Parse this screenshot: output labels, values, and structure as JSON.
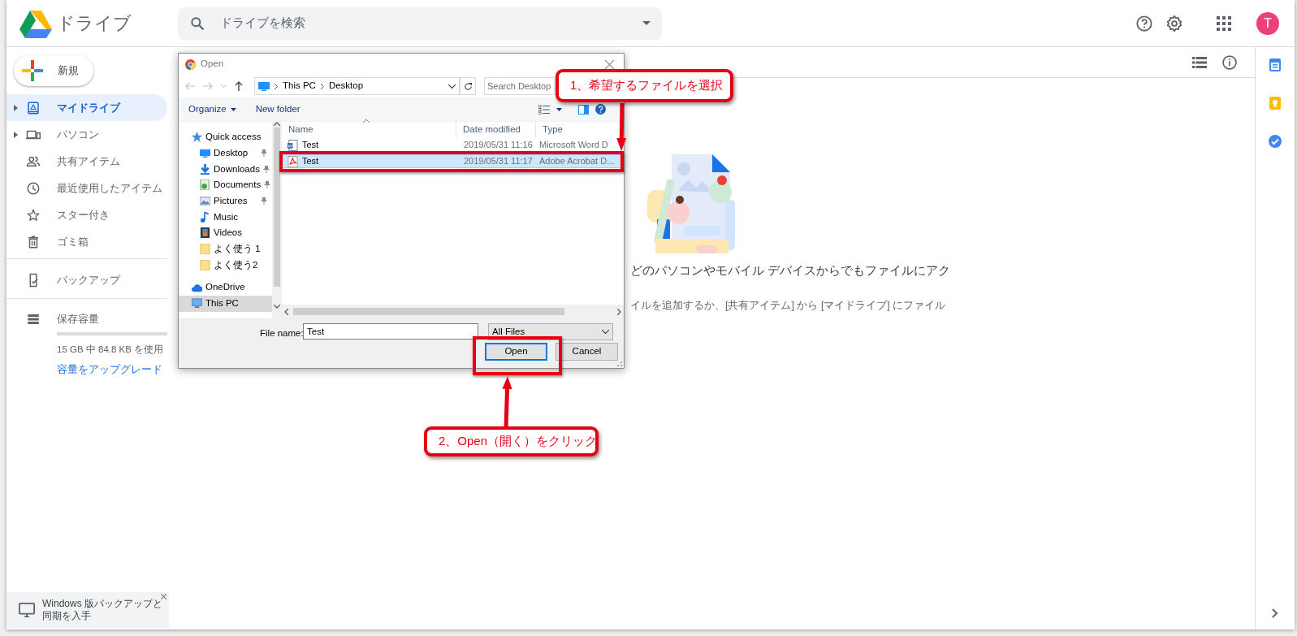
{
  "app": {
    "title": "ドライブ"
  },
  "search": {
    "placeholder": "ドライブを検索"
  },
  "account": {
    "initial": "T"
  },
  "new_button": {
    "label": "新規"
  },
  "sidebar": {
    "groups": [
      {
        "items": [
          {
            "label": "マイドライブ",
            "expandable": true,
            "selected": true
          },
          {
            "label": "パソコン",
            "expandable": true,
            "selected": false
          },
          {
            "label": "共有アイテム",
            "expandable": false,
            "selected": false
          },
          {
            "label": "最近使用したアイテム",
            "expandable": false,
            "selected": false
          },
          {
            "label": "スター付き",
            "expandable": false,
            "selected": false
          },
          {
            "label": "ゴミ箱",
            "expandable": false,
            "selected": false
          }
        ]
      },
      {
        "items": [
          {
            "label": "バックアップ",
            "expandable": false,
            "selected": false
          }
        ]
      }
    ]
  },
  "storage": {
    "label": "保存容量",
    "level": 0,
    "usage": "15 GB 中 84.8 KB を使用",
    "upgrade_link": "容量をアップグレード"
  },
  "backup_banner": {
    "text": "Windows 版バックアップと同期を入手"
  },
  "empty_state": {
    "line_1": "どのパソコンやモバイル デバイスからでもファイルにアク",
    "line_2": "イルを追加するか、[共有アイテム] から [マイドライブ] にファイル"
  },
  "dialog": {
    "title": "Open",
    "path": [
      "This PC",
      "Desktop"
    ],
    "search_placeholder": "Search Desktop",
    "organize": "Organize",
    "new_folder": "New folder",
    "nav": [
      {
        "label": "Quick access",
        "selected": false,
        "children": [
          {
            "label": "Desktop",
            "pinned": true,
            "selected": false
          },
          {
            "label": "Downloads",
            "pinned": true,
            "selected": false
          },
          {
            "label": "Documents",
            "pinned": true,
            "selected": false
          },
          {
            "label": "Pictures",
            "pinned": true,
            "selected": false
          },
          {
            "label": "Music",
            "pinned": false,
            "selected": false
          },
          {
            "label": "Videos",
            "pinned": false,
            "selected": false
          },
          {
            "label": "よく使う 1",
            "pinned": false,
            "selected": false
          },
          {
            "label": "よく使う2",
            "pinned": false,
            "selected": false
          }
        ]
      },
      {
        "label": "OneDrive",
        "selected": false
      },
      {
        "label": "This PC",
        "selected": true
      }
    ],
    "columns": [
      "Name",
      "Date modified",
      "Type"
    ],
    "files": [
      {
        "name": "Test",
        "modified": "2019/05/31 11:16",
        "type": "Microsoft Word D",
        "selected": false
      },
      {
        "name": "Test",
        "modified": "2019/05/31 11:17",
        "type": "Adobe Acrobat D...",
        "selected": true
      }
    ],
    "file_name": {
      "label": "File name:",
      "value": "Test"
    },
    "file_type": {
      "value": "All Files"
    },
    "buttons": [
      {
        "label": "Open",
        "default": true
      },
      {
        "label": "Cancel",
        "default": false
      }
    ]
  },
  "annotations": [
    {
      "text": "1、希望するファイルを選択"
    },
    {
      "text": "2、Open（開く）をクリック"
    }
  ]
}
